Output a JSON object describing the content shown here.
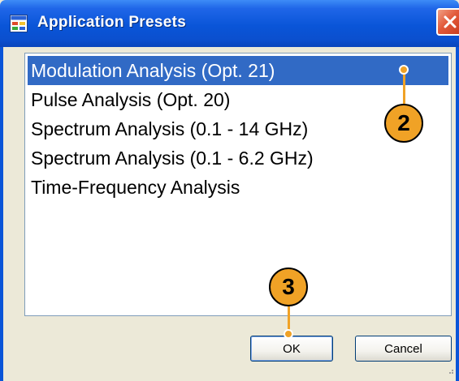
{
  "window": {
    "title": "Application Presets",
    "icons": {
      "app": "application-window-icon",
      "close": "close-icon"
    },
    "colors": {
      "titlebar": "#0a55d8",
      "close": "#e2593a",
      "selection": "#316ac5",
      "face": "#ece9d8",
      "callout": "#f0a226"
    }
  },
  "presets": {
    "items": [
      "Modulation Analysis (Opt. 21)",
      "Pulse Analysis (Opt. 20)",
      "Spectrum Analysis (0.1 - 14 GHz)",
      "Spectrum Analysis (0.1 - 6.2 GHz)",
      "Time-Frequency Analysis"
    ],
    "selected_index": 0
  },
  "buttons": {
    "ok": "OK",
    "cancel": "Cancel"
  },
  "callouts": {
    "list_callout": "2",
    "ok_callout": "3"
  }
}
